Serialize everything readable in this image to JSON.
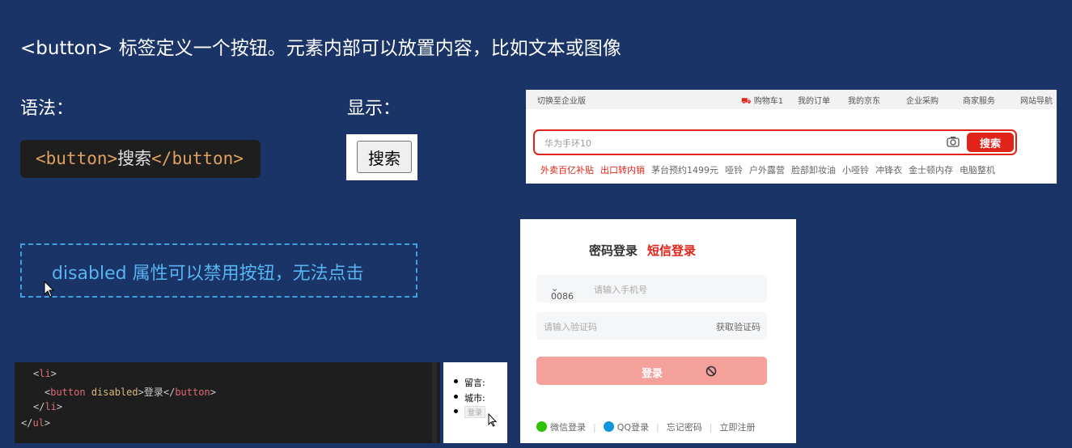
{
  "heading": "<button> 标签定义一个按钮。元素内部可以放置内容，比如文本或图像",
  "syntax_label": "语法：",
  "display_label": "显示：",
  "code_sample": {
    "open": "<button>",
    "text": "搜索",
    "close": "</button>"
  },
  "demo_button": "搜索",
  "note": "disabled 属性可以禁用按钮，无法点击",
  "jd": {
    "topbar": [
      "切换至企业版",
      "购物车1",
      "我的订单",
      "我的京东",
      "企业采购",
      "商家服务",
      "网站导航"
    ],
    "search_value": "华为手环10",
    "search_button": "搜索",
    "hot_red": [
      "外卖百亿补贴",
      "出口转内销"
    ],
    "hot": [
      "茅台预约1499元",
      "哑铃",
      "户外露营",
      "脸部卸妆油",
      "小哑铃",
      "冲锋衣",
      "金士顿内存",
      "电脑整机"
    ]
  },
  "login": {
    "tab_password": "密码登录",
    "tab_sms": "短信登录",
    "country_code": "0086",
    "phone_placeholder": "请输入手机号",
    "code_placeholder": "请输入验证码",
    "get_code": "获取验证码",
    "submit": "登录",
    "wechat": "微信登录",
    "qq": "QQ登录",
    "forgot": "忘记密码",
    "register": "立即注册"
  },
  "editor": {
    "line1_tag": "li",
    "line2_attr": "disabled",
    "line2_text": "登录",
    "line3_tag": "li",
    "line4_tag": "ul"
  },
  "preview": {
    "item1": "留言:",
    "item2": "城市:",
    "item3": "登录"
  },
  "colors": {
    "background": "#1a3467",
    "accent_red": "#e2231a",
    "note_blue": "#57b4f0"
  }
}
